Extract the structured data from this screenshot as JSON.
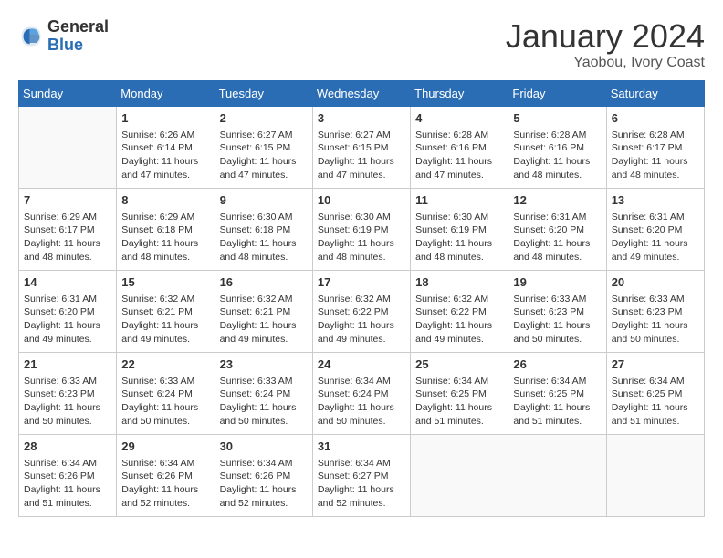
{
  "logo": {
    "general": "General",
    "blue": "Blue"
  },
  "title": "January 2024",
  "location": "Yaobou, Ivory Coast",
  "days": [
    "Sunday",
    "Monday",
    "Tuesday",
    "Wednesday",
    "Thursday",
    "Friday",
    "Saturday"
  ],
  "weeks": [
    [
      {
        "day": "",
        "info": ""
      },
      {
        "day": "1",
        "info": "Sunrise: 6:26 AM\nSunset: 6:14 PM\nDaylight: 11 hours and 47 minutes."
      },
      {
        "day": "2",
        "info": "Sunrise: 6:27 AM\nSunset: 6:15 PM\nDaylight: 11 hours and 47 minutes."
      },
      {
        "day": "3",
        "info": "Sunrise: 6:27 AM\nSunset: 6:15 PM\nDaylight: 11 hours and 47 minutes."
      },
      {
        "day": "4",
        "info": "Sunrise: 6:28 AM\nSunset: 6:16 PM\nDaylight: 11 hours and 47 minutes."
      },
      {
        "day": "5",
        "info": "Sunrise: 6:28 AM\nSunset: 6:16 PM\nDaylight: 11 hours and 48 minutes."
      },
      {
        "day": "6",
        "info": "Sunrise: 6:28 AM\nSunset: 6:17 PM\nDaylight: 11 hours and 48 minutes."
      }
    ],
    [
      {
        "day": "7",
        "info": "Sunrise: 6:29 AM\nSunset: 6:17 PM\nDaylight: 11 hours and 48 minutes."
      },
      {
        "day": "8",
        "info": "Sunrise: 6:29 AM\nSunset: 6:18 PM\nDaylight: 11 hours and 48 minutes."
      },
      {
        "day": "9",
        "info": "Sunrise: 6:30 AM\nSunset: 6:18 PM\nDaylight: 11 hours and 48 minutes."
      },
      {
        "day": "10",
        "info": "Sunrise: 6:30 AM\nSunset: 6:19 PM\nDaylight: 11 hours and 48 minutes."
      },
      {
        "day": "11",
        "info": "Sunrise: 6:30 AM\nSunset: 6:19 PM\nDaylight: 11 hours and 48 minutes."
      },
      {
        "day": "12",
        "info": "Sunrise: 6:31 AM\nSunset: 6:20 PM\nDaylight: 11 hours and 48 minutes."
      },
      {
        "day": "13",
        "info": "Sunrise: 6:31 AM\nSunset: 6:20 PM\nDaylight: 11 hours and 49 minutes."
      }
    ],
    [
      {
        "day": "14",
        "info": "Sunrise: 6:31 AM\nSunset: 6:20 PM\nDaylight: 11 hours and 49 minutes."
      },
      {
        "day": "15",
        "info": "Sunrise: 6:32 AM\nSunset: 6:21 PM\nDaylight: 11 hours and 49 minutes."
      },
      {
        "day": "16",
        "info": "Sunrise: 6:32 AM\nSunset: 6:21 PM\nDaylight: 11 hours and 49 minutes."
      },
      {
        "day": "17",
        "info": "Sunrise: 6:32 AM\nSunset: 6:22 PM\nDaylight: 11 hours and 49 minutes."
      },
      {
        "day": "18",
        "info": "Sunrise: 6:32 AM\nSunset: 6:22 PM\nDaylight: 11 hours and 49 minutes."
      },
      {
        "day": "19",
        "info": "Sunrise: 6:33 AM\nSunset: 6:23 PM\nDaylight: 11 hours and 50 minutes."
      },
      {
        "day": "20",
        "info": "Sunrise: 6:33 AM\nSunset: 6:23 PM\nDaylight: 11 hours and 50 minutes."
      }
    ],
    [
      {
        "day": "21",
        "info": "Sunrise: 6:33 AM\nSunset: 6:23 PM\nDaylight: 11 hours and 50 minutes."
      },
      {
        "day": "22",
        "info": "Sunrise: 6:33 AM\nSunset: 6:24 PM\nDaylight: 11 hours and 50 minutes."
      },
      {
        "day": "23",
        "info": "Sunrise: 6:33 AM\nSunset: 6:24 PM\nDaylight: 11 hours and 50 minutes."
      },
      {
        "day": "24",
        "info": "Sunrise: 6:34 AM\nSunset: 6:24 PM\nDaylight: 11 hours and 50 minutes."
      },
      {
        "day": "25",
        "info": "Sunrise: 6:34 AM\nSunset: 6:25 PM\nDaylight: 11 hours and 51 minutes."
      },
      {
        "day": "26",
        "info": "Sunrise: 6:34 AM\nSunset: 6:25 PM\nDaylight: 11 hours and 51 minutes."
      },
      {
        "day": "27",
        "info": "Sunrise: 6:34 AM\nSunset: 6:25 PM\nDaylight: 11 hours and 51 minutes."
      }
    ],
    [
      {
        "day": "28",
        "info": "Sunrise: 6:34 AM\nSunset: 6:26 PM\nDaylight: 11 hours and 51 minutes."
      },
      {
        "day": "29",
        "info": "Sunrise: 6:34 AM\nSunset: 6:26 PM\nDaylight: 11 hours and 52 minutes."
      },
      {
        "day": "30",
        "info": "Sunrise: 6:34 AM\nSunset: 6:26 PM\nDaylight: 11 hours and 52 minutes."
      },
      {
        "day": "31",
        "info": "Sunrise: 6:34 AM\nSunset: 6:27 PM\nDaylight: 11 hours and 52 minutes."
      },
      {
        "day": "",
        "info": ""
      },
      {
        "day": "",
        "info": ""
      },
      {
        "day": "",
        "info": ""
      }
    ]
  ]
}
